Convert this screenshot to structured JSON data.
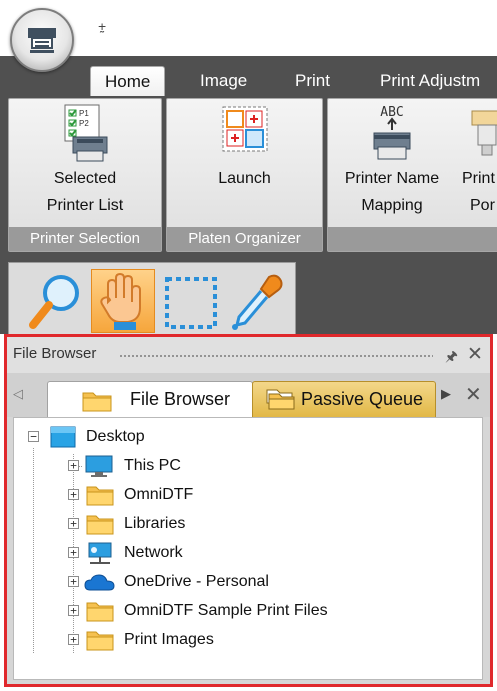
{
  "quick_access": {
    "arrow": "⨦"
  },
  "ribbon_tabs": [
    "Home",
    "Image",
    "Print",
    "Print Adjustm"
  ],
  "ribbon_groups": [
    {
      "label": "Printer Selection",
      "buttons": [
        {
          "label1": "Selected",
          "label2": "Printer List",
          "icon": "printer-list-icon"
        }
      ]
    },
    {
      "label": "Platen Organizer",
      "buttons": [
        {
          "label1": "Launch",
          "label2": "",
          "icon": "platen-organizer-icon"
        }
      ]
    },
    {
      "label": "",
      "buttons": [
        {
          "label1": "Printer Name",
          "label2": "Mapping",
          "icon": "printer-name-mapping-icon",
          "badge": "ABC"
        },
        {
          "label1": "Print",
          "label2": "Por",
          "icon": "printer-port-icon"
        }
      ]
    }
  ],
  "tools": [
    {
      "name": "zoom-tool",
      "icon": "magnifier-icon",
      "active": false
    },
    {
      "name": "pan-tool",
      "icon": "hand-icon",
      "active": true
    },
    {
      "name": "select-tool",
      "icon": "marquee-icon",
      "active": false
    },
    {
      "name": "eyedropper-tool",
      "icon": "eyedropper-icon",
      "active": false
    }
  ],
  "file_browser": {
    "title": "File Browser",
    "tabs": [
      {
        "label": "File Browser",
        "icon": "folder-icon",
        "active": true
      },
      {
        "label": "Passive Queue",
        "icon": "stacked-folder-icon",
        "active": false
      }
    ],
    "tree": {
      "root": {
        "label": "Desktop",
        "icon": "desktop-icon",
        "expanded": true
      },
      "children": [
        {
          "label": "This PC",
          "icon": "monitor-icon"
        },
        {
          "label": "OmniDTF",
          "icon": "folder-icon"
        },
        {
          "label": "Libraries",
          "icon": "folder-icon"
        },
        {
          "label": "Network",
          "icon": "network-icon"
        },
        {
          "label": "OneDrive - Personal",
          "icon": "cloud-icon"
        },
        {
          "label": "OmniDTF Sample Print Files",
          "icon": "folder-icon"
        },
        {
          "label": "Print Images",
          "icon": "folder-icon"
        }
      ]
    }
  },
  "colors": {
    "accent_orange": "#f6a63c",
    "dark_chrome": "#505050",
    "highlight_red": "#e0282c"
  }
}
